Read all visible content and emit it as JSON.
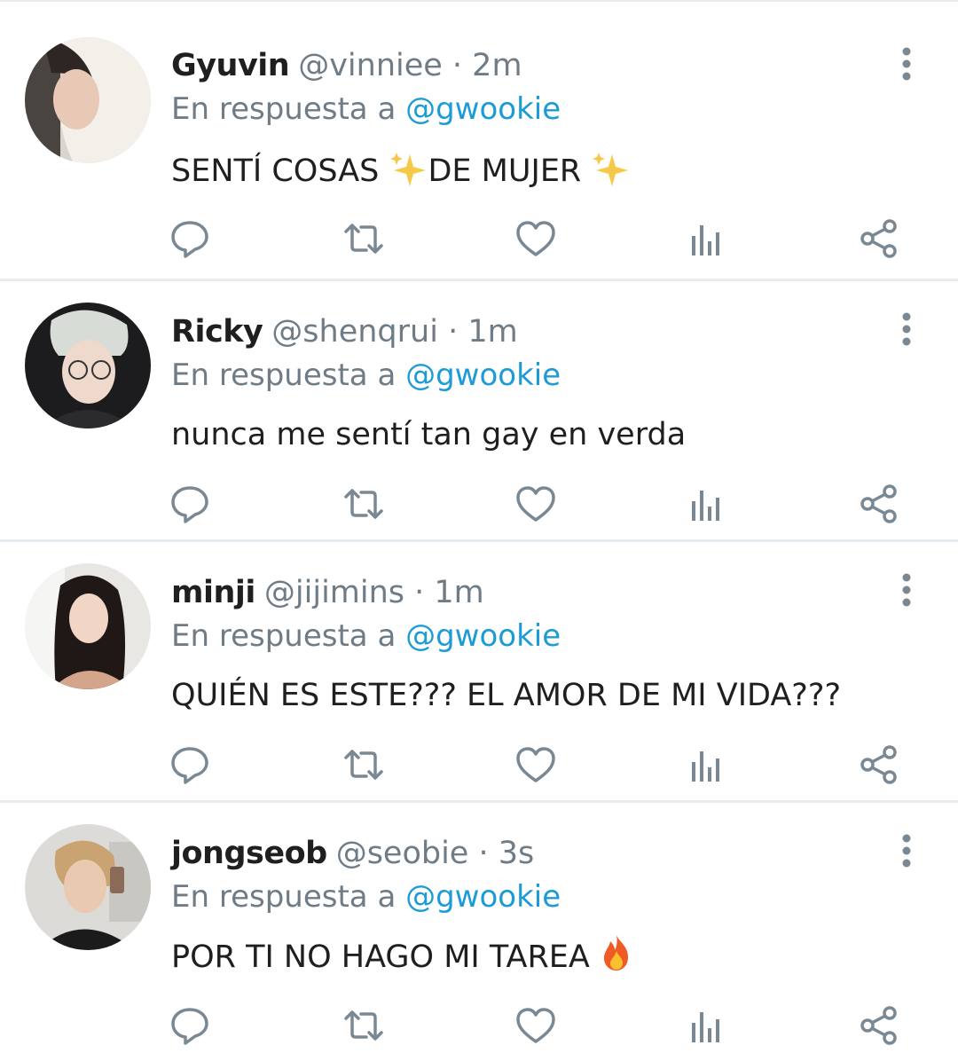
{
  "reply_prefix": "En respuesta a",
  "tweets": [
    {
      "name": "Gyuvin",
      "handle": "@vinniee · 2m",
      "reply_to": "@gwookie",
      "text_parts": [
        "SENTÍ COSAS ",
        "DE MUJER "
      ],
      "trailing_emoji": "sparkles"
    },
    {
      "name": "Ricky",
      "handle": "@shenqrui · 1m",
      "reply_to": "@gwookie",
      "text": "nunca me sentí tan gay en verda"
    },
    {
      "name": "minji",
      "handle": "@jijimins · 1m",
      "reply_to": "@gwookie",
      "text": "QUIÉN ES ESTE??? EL AMOR DE MI VIDA???"
    },
    {
      "name": "jongseob",
      "handle": "@seobie · 3s",
      "reply_to": "@gwookie",
      "text": "POR TI NO HAGO MI TAREA ",
      "trailing_emoji": "fire"
    }
  ],
  "actions": [
    "reply-icon",
    "retweet-icon",
    "like-icon",
    "analytics-icon",
    "share-icon"
  ],
  "colors": {
    "text": "#1f1f1f",
    "secondary": "#6f7c86",
    "mention": "#1d9bd6",
    "icon": "#7a8893",
    "divider": "#e6ecf0"
  }
}
